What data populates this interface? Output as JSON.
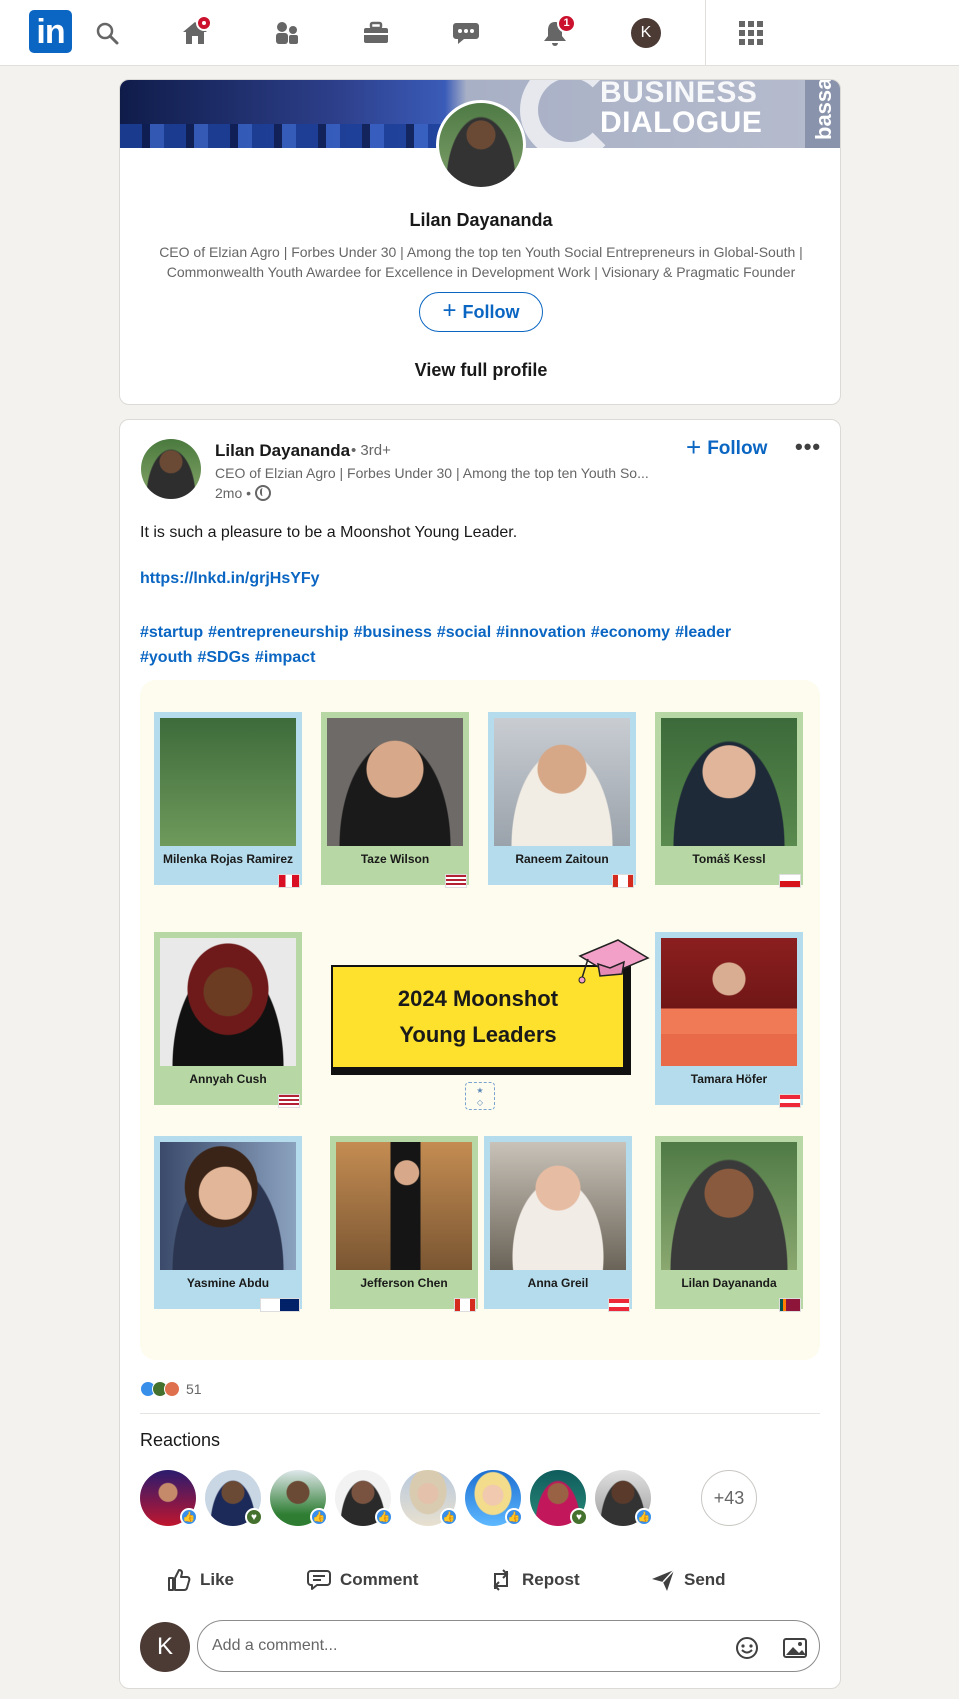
{
  "nav": {
    "logo_text": "in",
    "notification_count": "1",
    "avatar_initial": "K"
  },
  "profile_card": {
    "banner_text_line1": "BUSINESS",
    "banner_text_line2": "DIALOGUE",
    "banner_side_text": "bassa",
    "name": "Lilan Dayananda",
    "headline": "CEO of Elzian Agro | Forbes Under 30 | Among the top ten Youth Social Entrepreneurs in Global-South | Commonwealth Youth Awardee for Excellence in Development Work | Visionary & Pragmatic Founder",
    "follow_label": "Follow",
    "view_full_profile": "View full profile"
  },
  "post": {
    "author_name": "Lilan Dayananda",
    "degree": "• 3rd+",
    "author_headline": "CEO of Elzian Agro | Forbes Under 30 | Among the top ten Youth So...",
    "time": "2mo •",
    "follow_label": "Follow",
    "more_label": "•••",
    "text": "It is such a pleasure to be a Moonshot Young Leader.",
    "link": "https://lnkd.in/grjHsYFy",
    "hashtags": [
      "#startup",
      "#entrepreneurship",
      "#business",
      "#social",
      "#innovation",
      "#economy",
      "#leader",
      "#youth",
      "#SDGs",
      "#impact"
    ],
    "image": {
      "banner_line1": "2024 Moonshot",
      "banner_line2": "Young Leaders",
      "leaders": [
        {
          "name": "Milenka Rojas Ramirez"
        },
        {
          "name": "Taze Wilson"
        },
        {
          "name": "Raneem Zaitoun"
        },
        {
          "name": "Tomáš Kessl"
        },
        {
          "name": "Annyah Cush"
        },
        {
          "name": "Tamara Höfer"
        },
        {
          "name": "Yasmine Abdu"
        },
        {
          "name": "Jefferson Chen"
        },
        {
          "name": "Anna Greil"
        },
        {
          "name": "Lilan Dayananda"
        }
      ]
    },
    "reaction_count": "51",
    "reactions_title": "Reactions",
    "more_reactors": "+43",
    "actions": {
      "like": "Like",
      "comment": "Comment",
      "repost": "Repost",
      "send": "Send"
    },
    "comment_avatar_initial": "K",
    "comment_placeholder": "Add a comment..."
  },
  "colors": {
    "brand": "#0a66c2",
    "badge": "#cb112d",
    "banner_yellow": "#fde12d",
    "tile_blue": "#b5dcec",
    "tile_green": "#b7d8a4"
  }
}
